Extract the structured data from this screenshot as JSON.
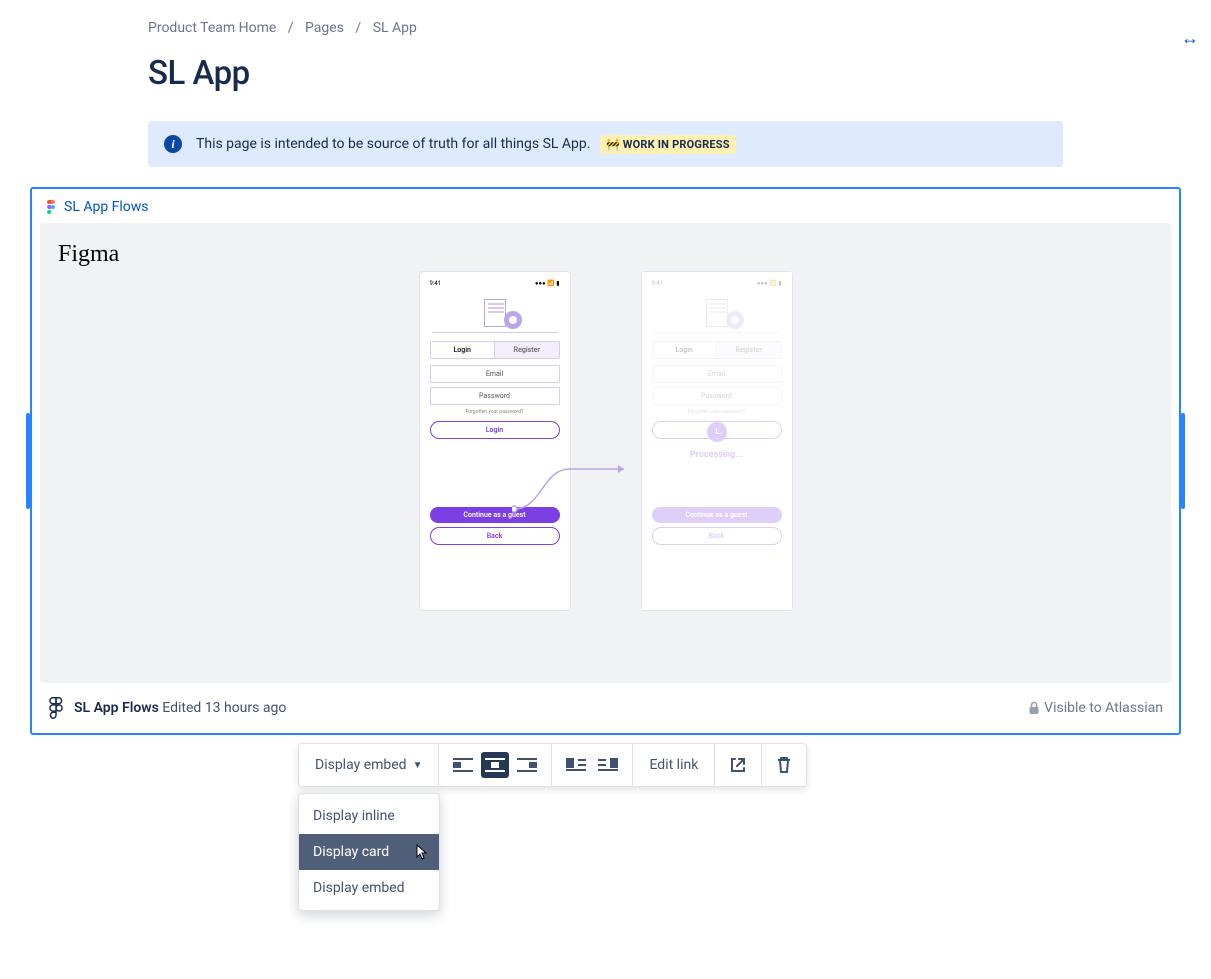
{
  "breadcrumb": {
    "items": [
      "Product Team Home",
      "Pages",
      "SL App"
    ]
  },
  "page": {
    "title": "SL App"
  },
  "info_panel": {
    "text": "This page is intended to be source of truth for all things SL App.",
    "badge": "🚧 WORK IN PROGRESS"
  },
  "embed": {
    "title": "SL App Flows",
    "figma_label": "Figma",
    "mock_login": {
      "time": "9:41",
      "tab_login": "Login",
      "tab_register": "Register",
      "email": "Email",
      "password": "Password",
      "forgot": "Forgotten your password?",
      "login_btn": "Login",
      "guest_btn": "Continue as a guest",
      "back_btn": "Back"
    },
    "mock_processing": {
      "label": "Processing..."
    },
    "footer": {
      "name": "SL App Flows",
      "edited": "Edited 13 hours ago",
      "visibility": "Visible to Atlassian"
    }
  },
  "toolbar": {
    "display_label": "Display embed",
    "edit_link": "Edit link"
  },
  "dropdown": {
    "items": [
      "Display inline",
      "Display card",
      "Display embed"
    ]
  }
}
